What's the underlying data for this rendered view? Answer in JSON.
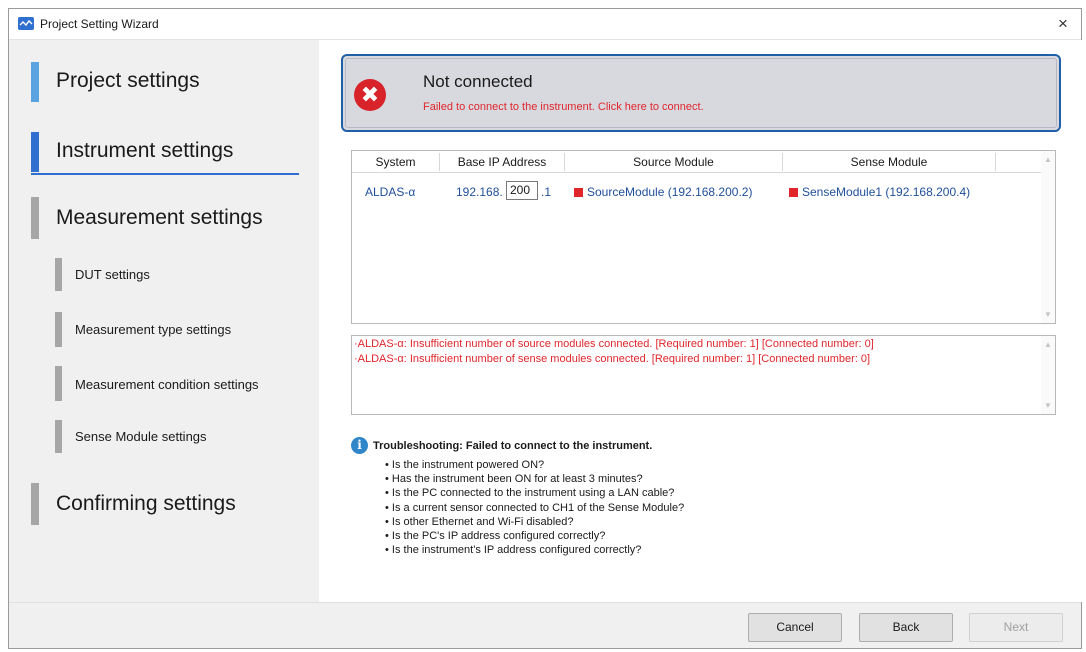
{
  "window": {
    "title": "Project Setting Wizard",
    "close_glyph": "×"
  },
  "sidebar": {
    "items": [
      {
        "label": "Project settings",
        "level": "main",
        "bar_color": "#5aa3e0"
      },
      {
        "label": "Instrument settings",
        "level": "main",
        "bar_color": "#2f6fd0",
        "active": true
      },
      {
        "label": "Measurement settings",
        "level": "main",
        "bar_color": "#a6a6a6"
      },
      {
        "label": "DUT settings",
        "level": "sub"
      },
      {
        "label": "Measurement type settings",
        "level": "sub"
      },
      {
        "label": "Measurement condition settings",
        "level": "sub"
      },
      {
        "label": "Sense Module settings",
        "level": "sub"
      },
      {
        "label": "Confirming settings",
        "level": "main",
        "bar_color": "#a6a6a6"
      }
    ]
  },
  "status": {
    "icon": "error-x-icon",
    "glyph": "✖",
    "title": "Not connected",
    "message": "Failed to connect to the instrument. Click here to connect.",
    "border_color": "#1f5fa8",
    "error_color": "#e0262b"
  },
  "instrument_table": {
    "headers": [
      "System",
      "Base IP Address",
      "Source Module",
      "Sense Module"
    ],
    "rows": [
      {
        "system": "ALDAS-α",
        "ip_prefix": "192.168.",
        "ip_value": "200",
        "ip_suffix": ".1",
        "source_module": "SourceModule (192.168.200.2)",
        "sense_module": "SenseModule1 (192.168.200.4)"
      }
    ]
  },
  "messages": [
    "·ALDAS-α: Insufficient number of source modules connected. [Required number: 1] [Connected number: 0]",
    "·ALDAS-α: Insufficient number of sense modules connected. [Required number: 1] [Connected number: 0]"
  ],
  "troubleshooting": {
    "icon_glyph": "i",
    "title": "Troubleshooting: Failed to connect to the instrument.",
    "items": [
      "• Is the instrument powered ON?",
      "• Has the instrument been ON for at least 3 minutes?",
      "• Is the PC connected to the instrument using a LAN cable?",
      "• Is a current sensor connected to CH1 of the Sense Module?",
      "• Is other Ethernet and Wi-Fi disabled?",
      "• Is the PC's IP address configured correctly?",
      "• Is the instrument's IP address configured correctly?"
    ]
  },
  "footer": {
    "cancel": "Cancel",
    "back": "Back",
    "next": "Next",
    "next_enabled": false
  },
  "scroll": {
    "up": "▲",
    "down": "▼"
  }
}
